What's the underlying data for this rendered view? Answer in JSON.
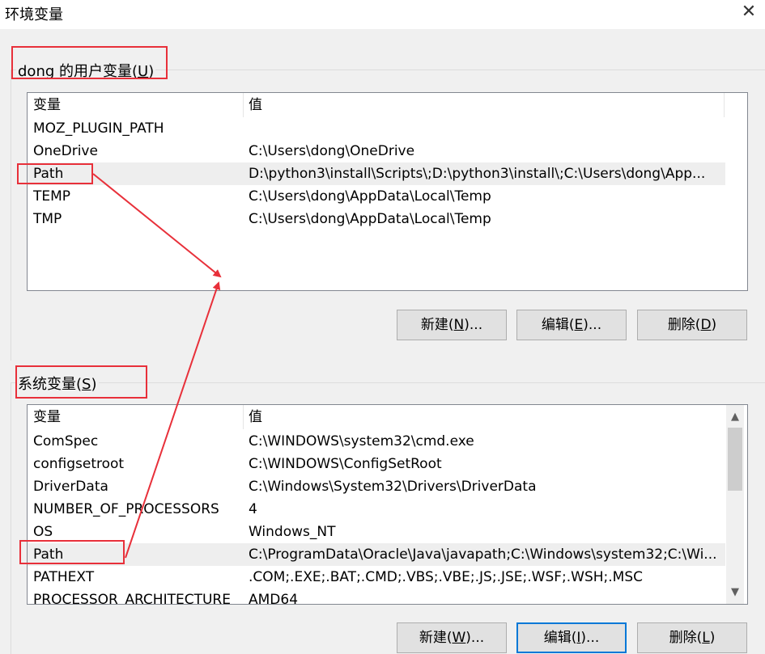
{
  "window": {
    "title": "环境变量",
    "close_glyph": "✕"
  },
  "user_vars": {
    "group_title_prefix": "dong 的用户变量(",
    "group_title_key": "U",
    "group_title_suffix": ")",
    "columns": {
      "name": "变量",
      "value": "值"
    },
    "rows": [
      {
        "name": "MOZ_PLUGIN_PATH",
        "value": ""
      },
      {
        "name": "OneDrive",
        "value": "C:\\Users\\dong\\OneDrive"
      },
      {
        "name": "Path",
        "value": "D:\\python3\\install\\Scripts\\;D:\\python3\\install\\;C:\\Users\\dong\\App..."
      },
      {
        "name": "TEMP",
        "value": "C:\\Users\\dong\\AppData\\Local\\Temp"
      },
      {
        "name": "TMP",
        "value": "C:\\Users\\dong\\AppData\\Local\\Temp"
      }
    ],
    "buttons": {
      "new": {
        "pre": "新建(",
        "key": "N",
        "post": ")..."
      },
      "edit": {
        "pre": "编辑(",
        "key": "E",
        "post": ")..."
      },
      "delete": {
        "pre": "删除(",
        "key": "D",
        "post": ")"
      }
    }
  },
  "system_vars": {
    "group_title_prefix": "系统变量(",
    "group_title_key": "S",
    "group_title_suffix": ")",
    "columns": {
      "name": "变量",
      "value": "值"
    },
    "rows": [
      {
        "name": "ComSpec",
        "value": "C:\\WINDOWS\\system32\\cmd.exe"
      },
      {
        "name": "configsetroot",
        "value": "C:\\WINDOWS\\ConfigSetRoot"
      },
      {
        "name": "DriverData",
        "value": "C:\\Windows\\System32\\Drivers\\DriverData"
      },
      {
        "name": "NUMBER_OF_PROCESSORS",
        "value": "4"
      },
      {
        "name": "OS",
        "value": "Windows_NT"
      },
      {
        "name": "Path",
        "value": "C:\\ProgramData\\Oracle\\Java\\javapath;C:\\Windows\\system32;C:\\Wi..."
      },
      {
        "name": "PATHEXT",
        "value": ".COM;.EXE;.BAT;.CMD;.VBS;.VBE;.JS;.JSE;.WSF;.WSH;.MSC"
      },
      {
        "name": "PROCESSOR_ARCHITECTURE",
        "value": "AMD64"
      }
    ],
    "buttons": {
      "new": {
        "pre": "新建(",
        "key": "W",
        "post": ")..."
      },
      "edit": {
        "pre": "编辑(",
        "key": "I",
        "post": ")..."
      },
      "delete": {
        "pre": "删除(",
        "key": "L",
        "post": ")"
      }
    },
    "scrollbar": {
      "up_glyph": "▲",
      "down_glyph": "▼"
    }
  },
  "colors": {
    "annotation_red": "#e8303a",
    "selection": "#eeeeee",
    "focus_blue": "#0078d7"
  }
}
